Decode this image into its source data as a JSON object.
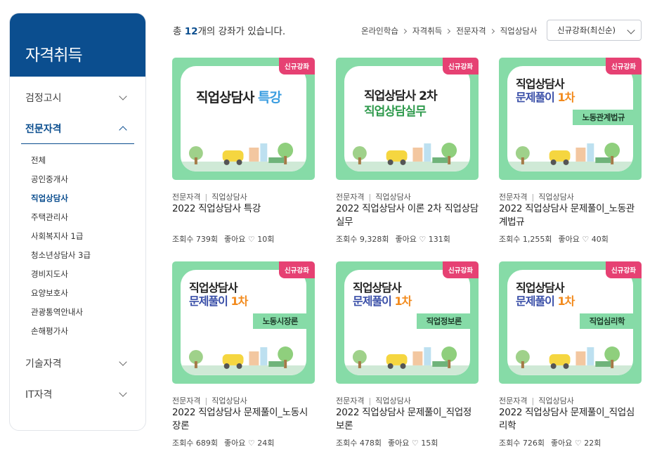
{
  "sidebar": {
    "title": "자격취득",
    "categories": [
      {
        "label": "검정고시"
      },
      {
        "label": "전문자격"
      },
      {
        "label": "기술자격"
      },
      {
        "label": "IT자격"
      }
    ],
    "sub_items": [
      {
        "label": "전체"
      },
      {
        "label": "공인중개사"
      },
      {
        "label": "직업상담사"
      },
      {
        "label": "주택관리사"
      },
      {
        "label": "사회복지사 1급"
      },
      {
        "label": "청소년상담사 3급"
      },
      {
        "label": "경비지도사"
      },
      {
        "label": "요양보호사"
      },
      {
        "label": "관광통역안내사"
      },
      {
        "label": "손해평가사"
      }
    ]
  },
  "header": {
    "count_prefix": "총 ",
    "count_value": "12",
    "count_suffix": "개의 강좌가 있습니다.",
    "breadcrumb": [
      "온라인학습",
      "자격취득",
      "전문자격",
      "직업상담사"
    ],
    "sort_label": "신규강좌(최신순)"
  },
  "cards": [
    {
      "badge": "신규강좌",
      "thumb_line1": "직업상담사",
      "thumb_line1_accent": "특강",
      "category": "전문자격",
      "subcategory": "직업상담사",
      "title": "2022 직업상담사 특강",
      "views_label": "조회수",
      "views": "739회",
      "likes_label": "좋아요",
      "likes": "10회"
    },
    {
      "badge": "신규강좌",
      "thumb_line1": "직업상담사 2차",
      "thumb_line2": "직업상담실무",
      "category": "전문자격",
      "subcategory": "직업상담사",
      "title": "2022 직업상담사 이론 2차 직업상담실무",
      "views_label": "조회수",
      "views": "9,328회",
      "likes_label": "좋아요",
      "likes": "131회"
    },
    {
      "badge": "신규강좌",
      "thumb_line1": "직업상담사",
      "thumb_line2a": "문제풀이",
      "thumb_line2b": "1차",
      "ribbon": "노동관계법규",
      "category": "전문자격",
      "subcategory": "직업상담사",
      "title": "2022 직업상담사 문제풀이_노동관계법규",
      "views_label": "조회수",
      "views": "1,255회",
      "likes_label": "좋아요",
      "likes": "40회"
    },
    {
      "badge": "신규강좌",
      "thumb_line1": "직업상담사",
      "thumb_line2a": "문제풀이",
      "thumb_line2b": "1차",
      "ribbon": "노동시장론",
      "category": "전문자격",
      "subcategory": "직업상담사",
      "title": "2022 직업상담사 문제풀이_노동시장론",
      "views_label": "조회수",
      "views": "689회",
      "likes_label": "좋아요",
      "likes": "24회"
    },
    {
      "badge": "신규강좌",
      "thumb_line1": "직업상담사",
      "thumb_line2a": "문제풀이",
      "thumb_line2b": "1차",
      "ribbon": "직업정보론",
      "category": "전문자격",
      "subcategory": "직업상담사",
      "title": "2022 직업상담사 문제풀이_직업정보론",
      "views_label": "조회수",
      "views": "478회",
      "likes_label": "좋아요",
      "likes": "15회"
    },
    {
      "badge": "신규강좌",
      "thumb_line1": "직업상담사",
      "thumb_line2a": "문제풀이",
      "thumb_line2b": "1차",
      "ribbon": "직업심리학",
      "category": "전문자격",
      "subcategory": "직업상담사",
      "title": "2022 직업상담사 문제풀이_직업심리학",
      "views_label": "조회수",
      "views": "726회",
      "likes_label": "좋아요",
      "likes": "22회"
    }
  ],
  "colors": {
    "brand": "#0b4e8f",
    "thumb_green": "#86dba7",
    "badge_pink": "#e64173",
    "accent_orange": "#f28a1c"
  }
}
